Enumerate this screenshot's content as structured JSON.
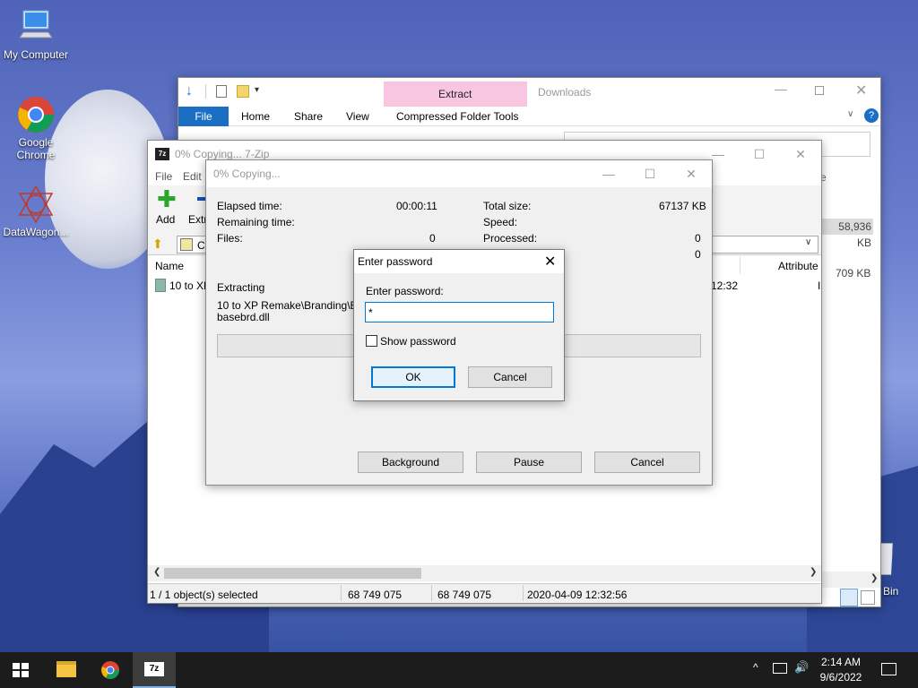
{
  "desktop": {
    "icons": [
      {
        "label": "My Computer"
      },
      {
        "label": "Google\nChrome"
      },
      {
        "label": "DataWagon..."
      }
    ],
    "recycle_label": "Bin"
  },
  "explorer": {
    "tab_extract": "Extract",
    "title": "Downloads",
    "menu": [
      "File",
      "Home",
      "Share",
      "View"
    ],
    "context_tab": "Compressed Folder Tools",
    "size_1": "58,936 KB",
    "size_2": "709 KB",
    "partial_e": "e"
  },
  "sevenzip": {
    "title": "0% Copying... 7-Zip",
    "menu": [
      "File",
      "Edit"
    ],
    "toolbar": [
      "Add",
      "Extr"
    ],
    "path_prefix": "C",
    "col_name": "Name",
    "col_attr": "Attribute",
    "row_name": "10 to XP",
    "row_time": "12:32",
    "row_attr": "I",
    "status": [
      "1 / 1 object(s) selected",
      "68 749 075",
      "68 749 075",
      "2020-04-09 12:32:56"
    ]
  },
  "progress": {
    "title": "0% Copying...",
    "elapsed_label": "Elapsed time:",
    "elapsed_value": "00:00:11",
    "remaining_label": "Remaining time:",
    "files_label": "Files:",
    "files_value": "0",
    "total_label": "Total size:",
    "total_value": "67137 KB",
    "speed_label": "Speed:",
    "processed_label": "Processed:",
    "processed_value": "0",
    "extra_value": "0",
    "extracting_label": "Extracting",
    "path_line1": "10 to XP Remake\\Branding\\Bas",
    "path_line2": "basebrd.dll",
    "background_btn": "Background",
    "pause_btn": "Pause",
    "cancel_btn": "Cancel",
    "progress_fraction": 0
  },
  "password_dialog": {
    "title": "Enter password",
    "label": "Enter password:",
    "value": "*",
    "show_password": "Show password",
    "ok": "OK",
    "cancel": "Cancel"
  },
  "taskbar": {
    "time": "2:14 AM",
    "date": "9/6/2022"
  },
  "colors": {
    "accent": "#0078d7",
    "ribbon_highlight": "#f9c6e2",
    "taskbar": "#1c1c1c"
  }
}
